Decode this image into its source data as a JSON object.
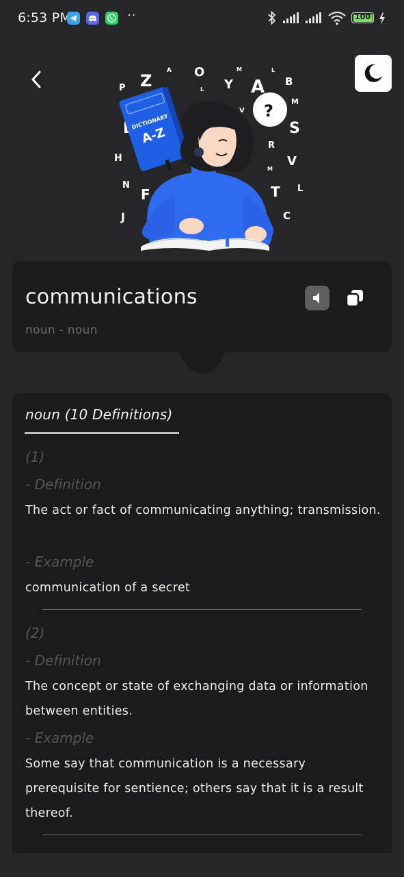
{
  "status_bar": {
    "time": "6:53 PM",
    "notification_icons": [
      "telegram-icon",
      "discord-icon",
      "whatsapp-icon"
    ],
    "overflow": "··",
    "battery": "100"
  },
  "header": {
    "back_icon": "chevron-left-icon",
    "theme_icon": "moon-icon"
  },
  "illustration": {
    "book_line1": "DICTIONARY",
    "book_line2": "A-Z",
    "question": "?"
  },
  "word": {
    "title": "communications",
    "part_of_speech": "noun - noun",
    "speaker_icon": "speaker-icon",
    "copy_icon": "copy-icon"
  },
  "definitions": {
    "heading": "noun (10 Definitions)",
    "definition_label": "- Definition",
    "example_label": "- Example",
    "items": [
      {
        "number": "(1)",
        "definition": "The act or fact of communicating anything; transmission.",
        "example": "communication of a secret"
      },
      {
        "number": "(2)",
        "definition": "The concept or state of exchanging data or information between entities.",
        "example": "Some say that communication is a necessary prerequisite for sentience; others say that it is a result thereof."
      }
    ]
  },
  "colors": {
    "background": "#262628",
    "card": "#1b1b1d",
    "accent_blue": "#2f6bf0",
    "muted_text": "#56565a"
  }
}
